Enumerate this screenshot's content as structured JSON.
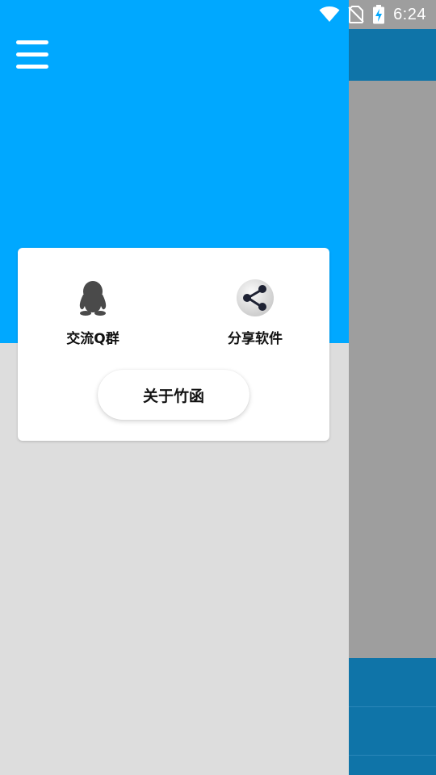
{
  "status_bar": {
    "time": "6:24",
    "icons": [
      "wifi-icon",
      "no-sim-icon",
      "battery-charging-icon"
    ]
  },
  "drawer": {
    "menu_icon": "hamburger-menu-icon",
    "card": {
      "items": [
        {
          "icon": "qq-penguin-icon",
          "label": "交流Q群"
        },
        {
          "icon": "share-icon",
          "label": "分享软件"
        }
      ],
      "about_button": "关于竹函"
    }
  },
  "colors": {
    "header_blue": "#00a8ff",
    "scrim_gray": "#9e9e9e",
    "app_bar_dark_blue": "#0f74a8",
    "drawer_bg": "#dddddd"
  }
}
